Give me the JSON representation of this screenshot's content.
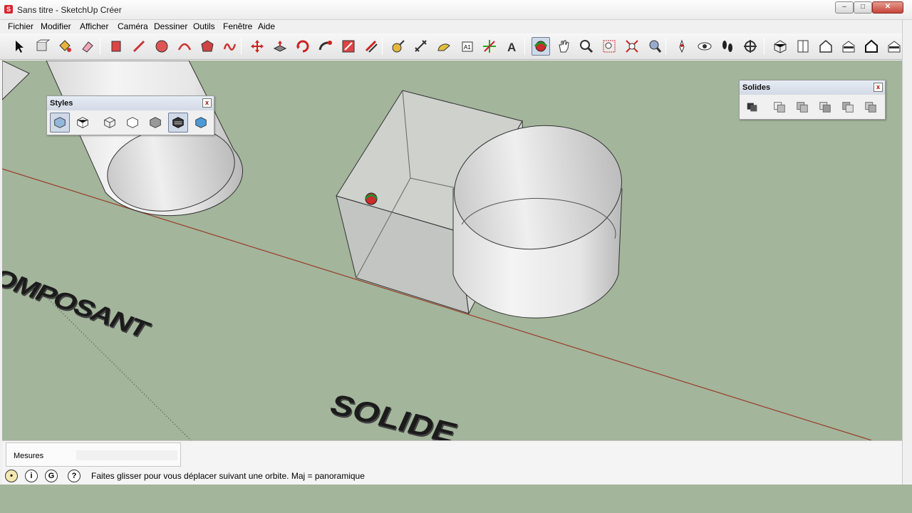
{
  "window": {
    "title": "Sans titre - SketchUp Créer",
    "app_icon": "sketchup-logo-icon",
    "minimize": "–",
    "maximize": "□",
    "close": "✕"
  },
  "menu": [
    "Fichier",
    "Modifier",
    "Afficher",
    "Caméra",
    "Dessiner",
    "Outils",
    "Fenêtre",
    "Aide"
  ],
  "toolbar": {
    "tools": [
      "select-icon",
      "make-component-icon",
      "paint-bucket-icon",
      "eraser-icon",
      "rectangle-icon",
      "line-icon",
      "circle-icon",
      "arc-icon",
      "polygon-icon",
      "freehand-icon",
      "move-icon",
      "push-pull-icon",
      "rotate-icon",
      "follow-me-icon",
      "scale-icon",
      "offset-icon",
      "tape-measure-icon",
      "dimension-icon",
      "protractor-icon",
      "text-icon",
      "axes-icon",
      "3d-text-icon",
      "orbit-icon",
      "pan-icon",
      "zoom-icon",
      "zoom-window-icon",
      "zoom-extents-icon",
      "previous-view-icon",
      "position-camera-icon",
      "look-around-icon",
      "walk-icon",
      "section-plane-icon",
      "iso-view-icon",
      "top-view-icon",
      "front-view-icon",
      "right-view-icon",
      "back-view-icon",
      "left-view-icon"
    ],
    "active_tool": "orbit-icon"
  },
  "styles_panel": {
    "title": "Styles",
    "close": "x",
    "tools": [
      "xray-icon",
      "back-edges-icon",
      "wireframe-icon",
      "hidden-line-icon",
      "shaded-icon",
      "shaded-textures-icon",
      "monochrome-icon"
    ],
    "active": [
      "xray-icon",
      "shaded-textures-icon"
    ]
  },
  "solids_panel": {
    "title": "Solides",
    "close": "x",
    "tools": [
      "outer-shell-icon",
      "intersect-icon",
      "union-icon",
      "subtract-icon",
      "trim-icon",
      "split-icon"
    ]
  },
  "scene": {
    "labels": {
      "composant": "OMPOSANT",
      "solide": "SOLIDE"
    }
  },
  "measurements": {
    "label": "Mesures",
    "value": ""
  },
  "status": {
    "icons": [
      "geo-location-icon",
      "credits-icon",
      "sign-in-icon",
      "help-icon"
    ],
    "text": "Faites glisser pour vous déplacer suivant une orbite.  Maj = panoramique"
  },
  "colors": {
    "ground": "#a3b59b",
    "axis_red": "#9b3b2b",
    "toolbar_active": "#cfd9e8"
  }
}
